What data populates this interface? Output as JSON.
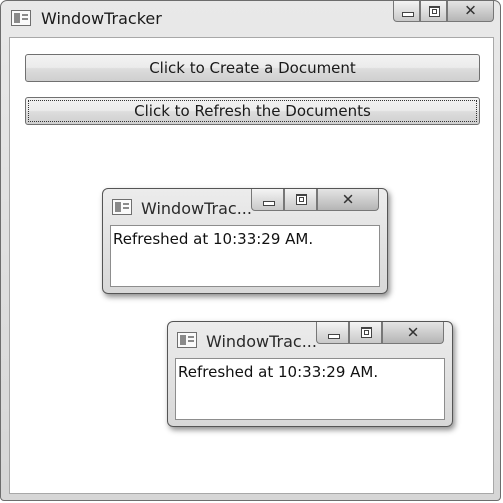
{
  "main_window": {
    "title": "WindowTracker",
    "create_button_label": "Click to Create a Document",
    "refresh_button_label": "Click to Refresh the Documents"
  },
  "documents": [
    {
      "title": "WindowTrac...",
      "status": "Refreshed at 10:33:29 AM."
    },
    {
      "title": "WindowTrac...",
      "status": "Refreshed at 10:33:29 AM."
    }
  ],
  "icons": {
    "app": "window-icon",
    "minimize": "minimize-icon",
    "maximize": "maximize-icon",
    "close": "close-icon"
  },
  "close_glyph": "✕"
}
